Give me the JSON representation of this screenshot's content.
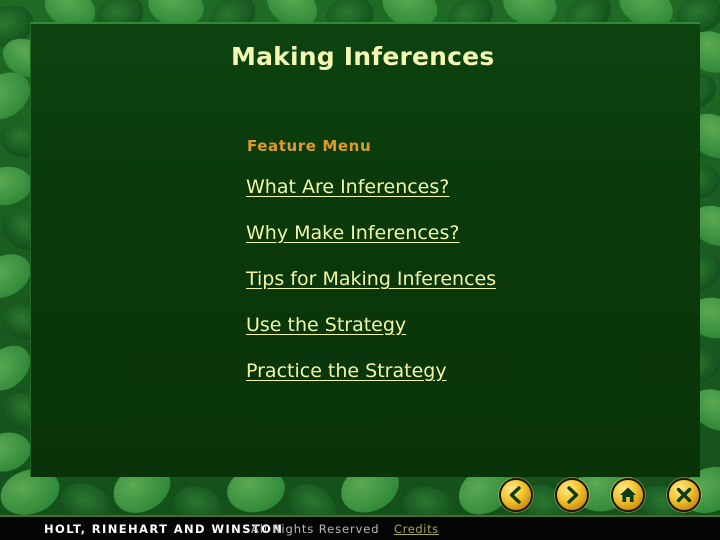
{
  "window": {
    "title": "Making Inferences"
  },
  "colors": {
    "panel_bg": "#0a3a0b",
    "title_text": "#f4f7b4",
    "feature_label": "#e09a2a",
    "link_text": "#f2f6a8",
    "button_gold": "#f5c430",
    "footer_bg": "#050505",
    "credits_link": "#a8a84a",
    "leaf_green": "#2e7d32"
  },
  "main": {
    "title": "Making Inferences",
    "feature_menu_label": "Feature Menu",
    "menu_items": [
      {
        "label": "What Are Inferences?",
        "name": "menu-link-what-are-inferences"
      },
      {
        "label": "Why Make Inferences?",
        "name": "menu-link-why-make-inferences"
      },
      {
        "label": "Tips for Making Inferences",
        "name": "menu-link-tips-for-making-inferences"
      },
      {
        "label": "Use the Strategy",
        "name": "menu-link-use-the-strategy"
      },
      {
        "label": "Practice the Strategy",
        "name": "menu-link-practice-the-strategy"
      }
    ]
  },
  "navbar": {
    "buttons": [
      {
        "label": "Previous",
        "icon": "chevron-left-icon"
      },
      {
        "label": "Next",
        "icon": "chevron-right-icon"
      },
      {
        "label": "Collection\nMenu",
        "icon": "home-icon"
      },
      {
        "label": "Exit",
        "icon": "close-x-icon"
      }
    ]
  },
  "footer": {
    "publisher": "HOLT, RINEHART AND WINSTON",
    "rights": "All Rights Reserved",
    "credits": "Credits"
  }
}
